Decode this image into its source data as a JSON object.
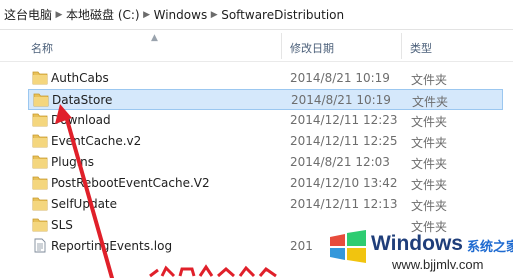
{
  "breadcrumb": [
    "这台电脑",
    "本地磁盘 (C:)",
    "Windows",
    "SoftwareDistribution"
  ],
  "columns": {
    "name": "名称",
    "date": "修改日期",
    "type": "类型"
  },
  "files": [
    {
      "name": "AuthCabs",
      "date": "2014/8/21 10:19",
      "type": "文件夹",
      "icon": "folder-icon",
      "selected": false
    },
    {
      "name": "DataStore",
      "date": "2014/8/21 10:19",
      "type": "文件夹",
      "icon": "folder-icon",
      "selected": true
    },
    {
      "name": "Download",
      "date": "2014/12/11 12:23",
      "type": "文件夹",
      "icon": "folder-icon",
      "selected": false
    },
    {
      "name": "EventCache.v2",
      "date": "2014/12/11 12:25",
      "type": "文件夹",
      "icon": "folder-icon",
      "selected": false
    },
    {
      "name": "Plugins",
      "date": "2014/8/21 12:03",
      "type": "文件夹",
      "icon": "folder-icon",
      "selected": false
    },
    {
      "name": "PostRebootEventCache.V2",
      "date": "2014/12/10 13:42",
      "type": "文件夹",
      "icon": "folder-icon",
      "selected": false
    },
    {
      "name": "SelfUpdate",
      "date": "2014/12/11 12:13",
      "type": "文件夹",
      "icon": "folder-icon",
      "selected": false
    },
    {
      "name": "SLS",
      "date": "",
      "type": "文件夹",
      "icon": "folder-icon",
      "selected": false
    },
    {
      "name": "ReportingEvents.log",
      "date": "201",
      "type": "",
      "icon": "text-file-icon",
      "selected": false
    }
  ],
  "watermark": {
    "brand": "Windows",
    "cn": "系统之家",
    "url": "www.bjjmlv.com"
  },
  "colors": {
    "selection": "#d5e8fb",
    "folder": "#e8c15a",
    "annotation": "#e0202a"
  }
}
